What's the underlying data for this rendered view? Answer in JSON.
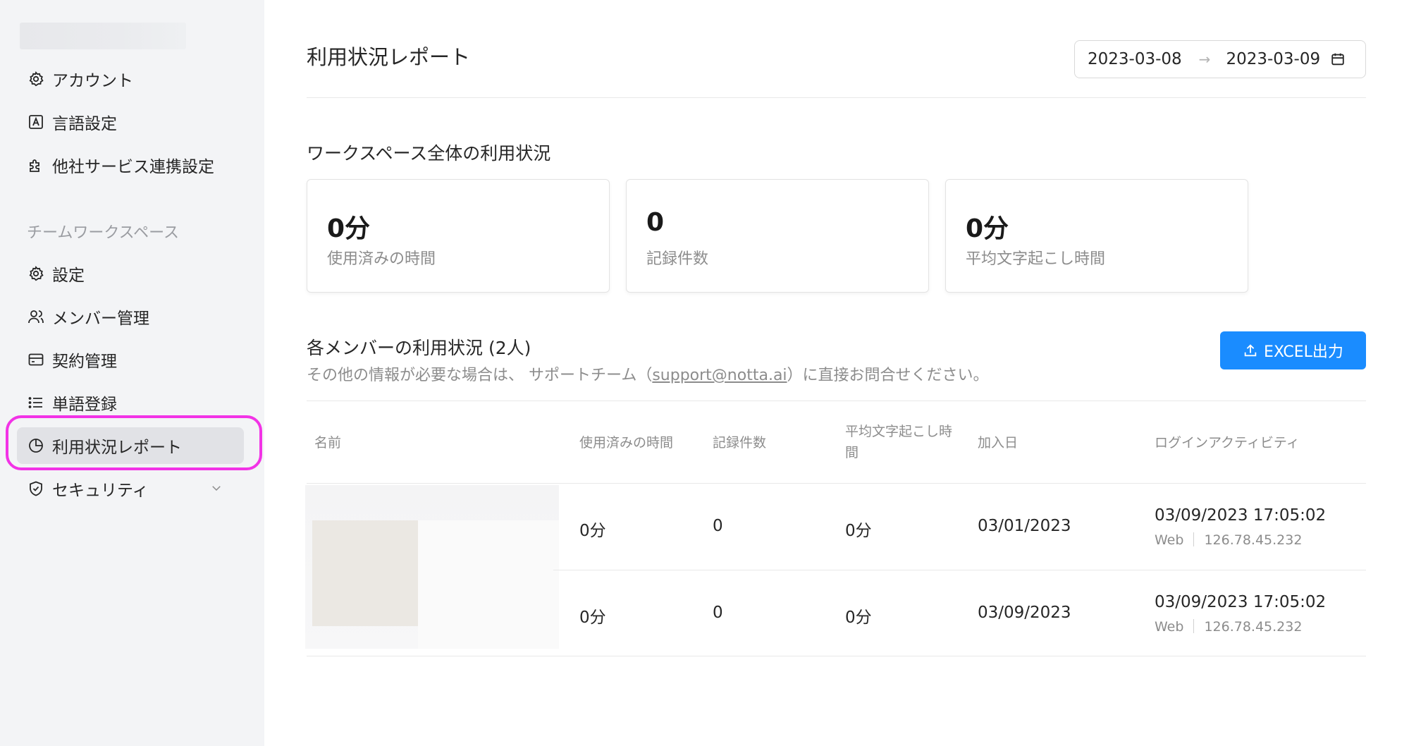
{
  "sidebar": {
    "account": "アカウント",
    "language": "言語設定",
    "integrations": "他社サービス連携設定",
    "section_label": "チームワークスペース",
    "settings": "設定",
    "members": "メンバー管理",
    "contract": "契約管理",
    "vocabulary": "単語登録",
    "usage_report": "利用状況レポート",
    "security": "セキュリティ"
  },
  "header": {
    "title": "利用状況レポート",
    "date_from": "2023-03-08",
    "date_arrow": "→",
    "date_to": "2023-03-09"
  },
  "workspace": {
    "title": "ワークスペース全体の利用状況",
    "stats": [
      {
        "value": "0分",
        "label": "使用済みの時間"
      },
      {
        "value": "0",
        "label": "記録件数"
      },
      {
        "value": "0分",
        "label": "平均文字起こし時間"
      }
    ]
  },
  "members": {
    "title": "各メンバーの利用状況 (2人)",
    "note_prefix": "その他の情報が必要な場合は、 サポートチーム（",
    "note_email": "support@notta.ai",
    "note_suffix": "）に直接お問合せください。",
    "export_label": "EXCEL出力",
    "columns": {
      "name": "名前",
      "used_time": "使用済みの時間",
      "records": "記録件数",
      "avg_line1": "平均文字起こし時",
      "avg_line2": "間",
      "joined": "加入日",
      "login": "ログインアクティビティ"
    },
    "rows": [
      {
        "used": "0分",
        "records": "0",
        "avg": "0分",
        "joined": "03/01/2023",
        "login_time": "03/09/2023 17:05:02",
        "login_platform": "Web",
        "login_ip": "126.78.45.232"
      },
      {
        "used": "0分",
        "records": "0",
        "avg": "0分",
        "joined": "03/09/2023",
        "login_time": "03/09/2023 17:05:02",
        "login_platform": "Web",
        "login_ip": "126.78.45.232"
      }
    ]
  },
  "colors": {
    "primary": "#1a8cff",
    "highlight": "#f233e6",
    "sidebar_bg": "#f3f4f6"
  }
}
